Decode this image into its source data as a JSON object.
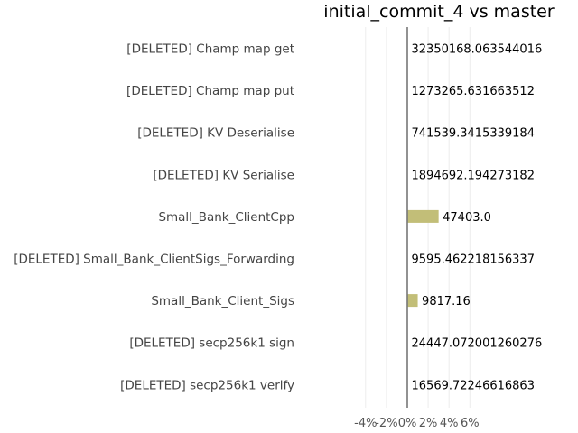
{
  "chart_data": {
    "type": "bar",
    "orientation": "horizontal",
    "title": "initial_commit_4 vs master",
    "xlabel": "",
    "ylabel": "",
    "xlim": [
      -4.6,
      6.5
    ],
    "x_ticks": [
      -4,
      -2,
      0,
      2,
      4,
      6
    ],
    "x_tick_labels": [
      "-4%",
      "-2%",
      "0%",
      "2%",
      "4%",
      "6%"
    ],
    "grid": "vertical",
    "bar_color": "#c2be78",
    "axis_line_color": "#777777",
    "categories": [
      "[DELETED] Champ map get",
      "[DELETED] Champ map put",
      "[DELETED] KV Deserialise",
      "[DELETED] KV Serialise",
      "Small_Bank_ClientCpp",
      "[DELETED] Small_Bank_ClientSigs_Forwarding",
      "Small_Bank_Client_Sigs",
      "[DELETED] secp256k1 sign",
      "[DELETED] secp256k1 verify"
    ],
    "values": [
      0,
      0,
      0,
      0,
      3.0,
      0,
      1.0,
      0,
      0
    ],
    "data_labels": [
      "32350168.063544016",
      "1273265.631663512",
      "741539.3415339184",
      "1894692.194273182",
      "47403.0",
      "9595.462218156337",
      "9817.16",
      "24447.072001260276",
      "16569.72246616863"
    ]
  }
}
